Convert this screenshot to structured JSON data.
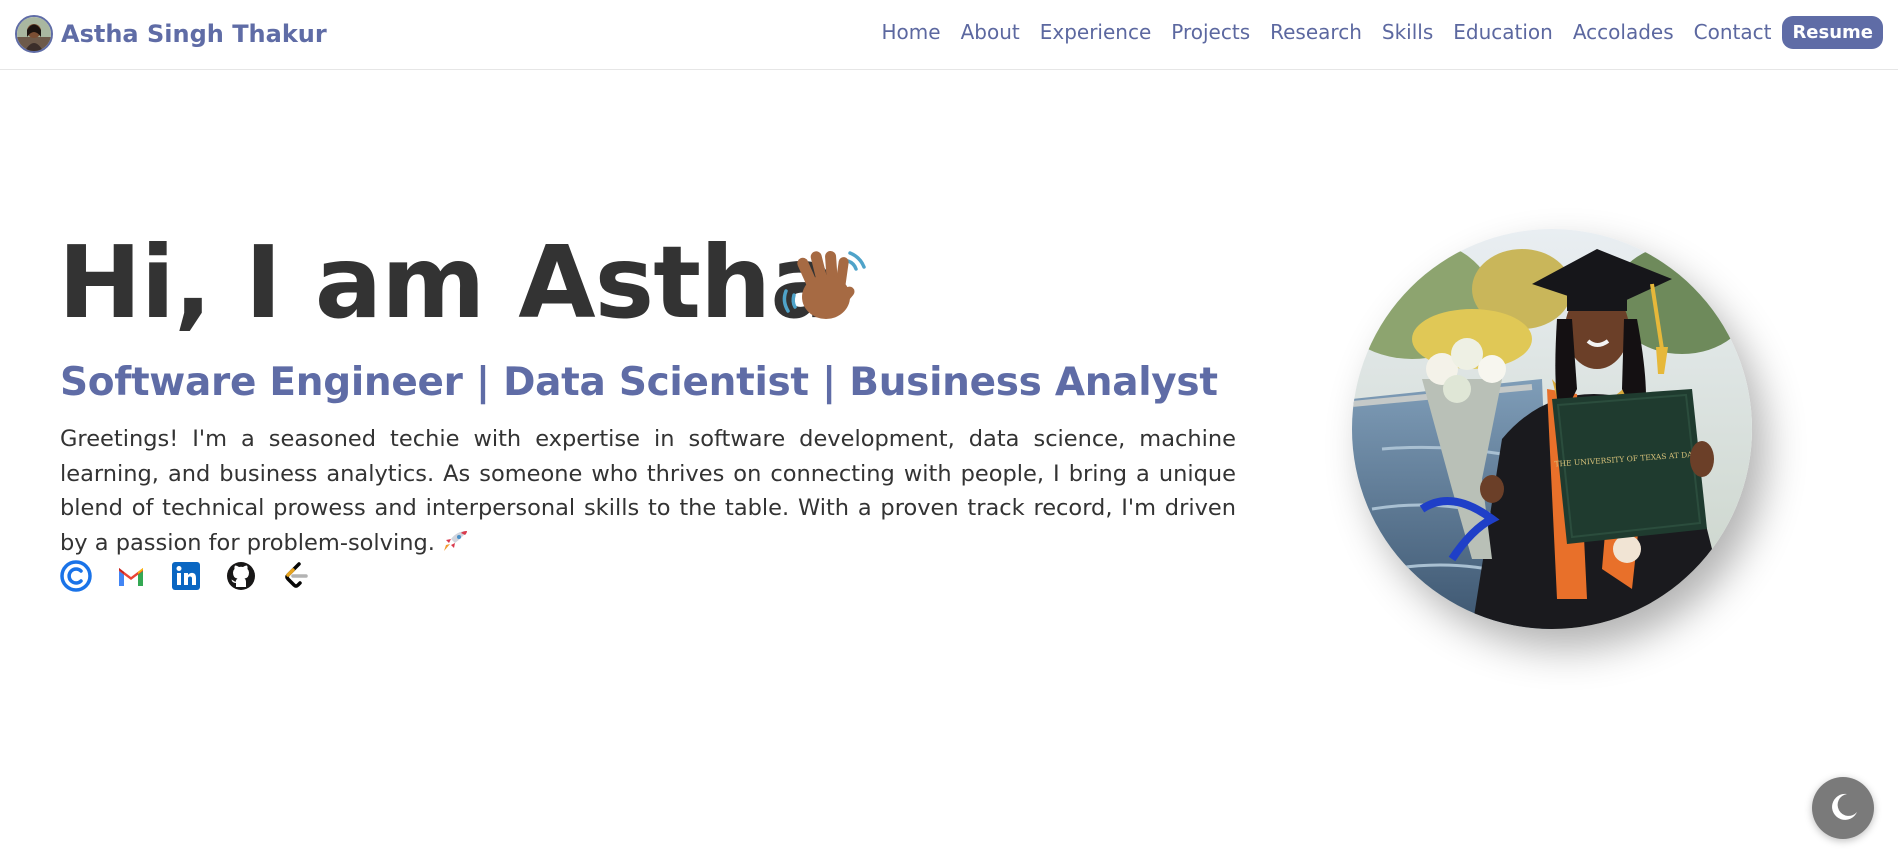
{
  "header": {
    "brand_name": "Astha Singh Thakur",
    "brand_avatar_icon": "profile-avatar",
    "nav": [
      {
        "label": "Home"
      },
      {
        "label": "About"
      },
      {
        "label": "Experience"
      },
      {
        "label": "Projects"
      },
      {
        "label": "Research"
      },
      {
        "label": "Skills"
      },
      {
        "label": "Education"
      },
      {
        "label": "Accolades"
      },
      {
        "label": "Contact"
      }
    ],
    "resume_label": "Resume"
  },
  "hero": {
    "greeting": "Hi, I am Astha",
    "greeting_icon": "waving-hand-icon",
    "subtitle": "Software Engineer | Data Scientist | Business Analyst",
    "description": "Greetings! I'm a seasoned techie with expertise in software development, data science, machine learning, and business analytics. As someone who thrives on connecting with people, I bring a unique blend of technical prowess and interpersonal skills to the table. With a proven track record, I'm driven by a passion for problem-solving.",
    "description_icon": "rocket-icon",
    "socials": [
      {
        "name": "calendly-icon"
      },
      {
        "name": "gmail-icon"
      },
      {
        "name": "linkedin-icon"
      },
      {
        "name": "github-icon"
      },
      {
        "name": "leetcode-icon"
      }
    ],
    "photo_text": "THE UNIVERSITY OF TEXAS AT DALLAS"
  },
  "theme_toggle_icon": "moon-icon",
  "colors": {
    "accent": "#5f6ca6",
    "text": "#333333",
    "toggle": "#7a7a7a"
  }
}
